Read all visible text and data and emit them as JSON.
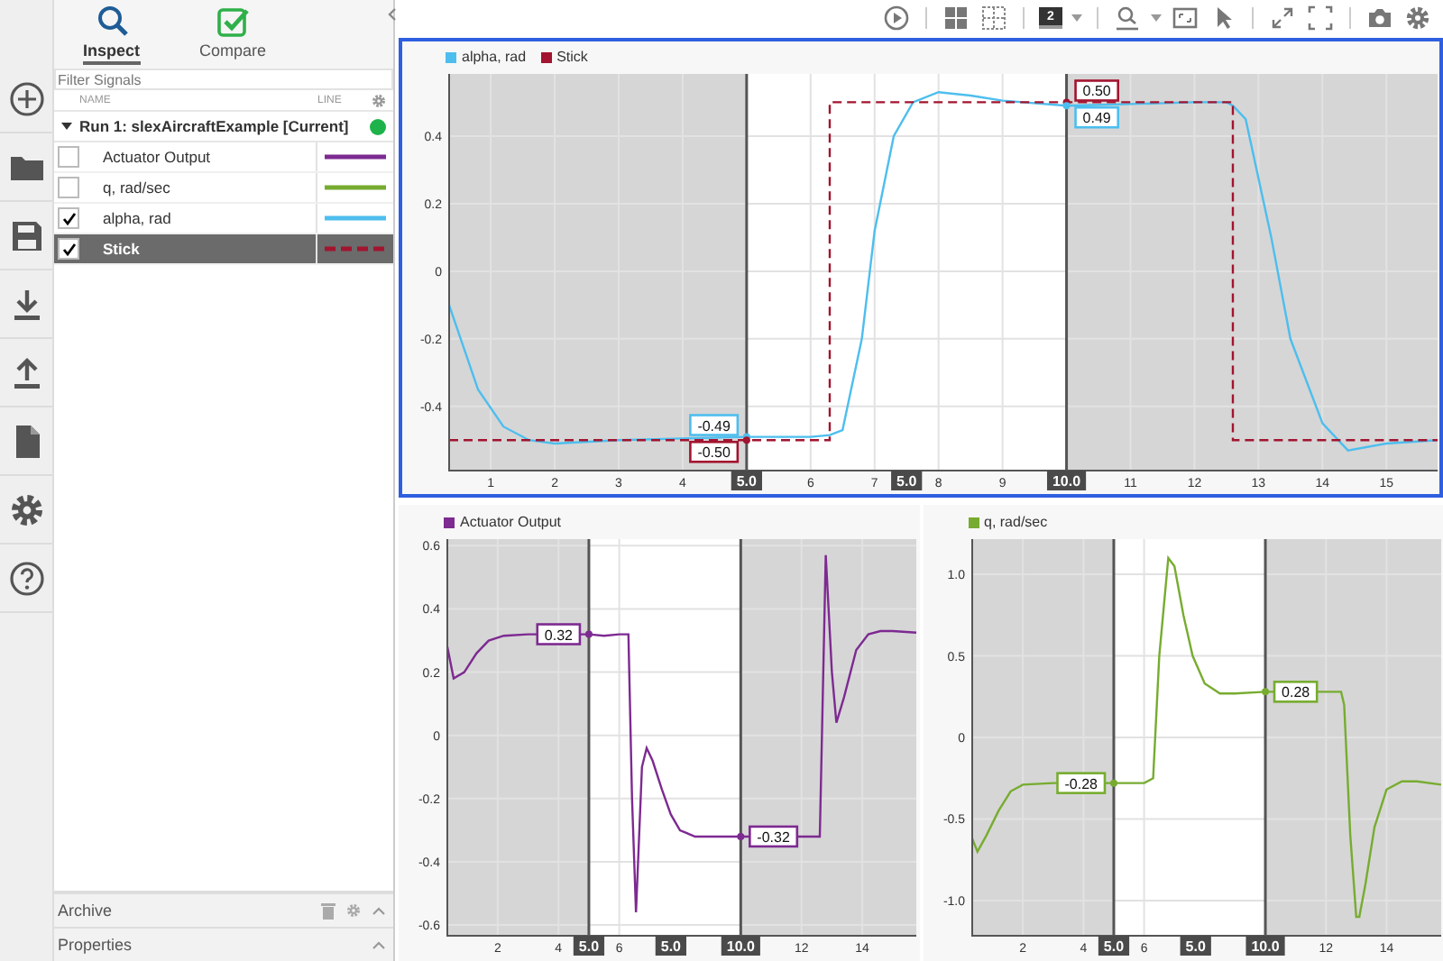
{
  "tabs": [
    {
      "label": "Inspect",
      "selected": true
    },
    {
      "label": "Compare",
      "selected": false
    }
  ],
  "filter": {
    "placeholder": "Filter Signals"
  },
  "columns": [
    "NAME",
    "LINE"
  ],
  "run": {
    "label": "Run 1: slexAircraftExample [Current]",
    "expanded": true
  },
  "signals": [
    {
      "name": "Actuator Output",
      "checked": false,
      "selected": false,
      "color": "#7d2a91",
      "dashed": false
    },
    {
      "name": "q, rad/sec",
      "checked": false,
      "selected": false,
      "color": "#77ac30",
      "dashed": false
    },
    {
      "name": "alpha, rad",
      "checked": true,
      "selected": false,
      "color": "#4dbeee",
      "dashed": false
    },
    {
      "name": "Stick",
      "checked": true,
      "selected": true,
      "color": "#a2142f",
      "dashed": true
    }
  ],
  "sections": [
    {
      "title": "Archive",
      "kind": "actions"
    },
    {
      "title": "Properties",
      "kind": "plain"
    }
  ],
  "toolbar": {
    "layout_label": "2"
  },
  "plots": [
    {
      "selected": true,
      "chart_data": {
        "type": "line",
        "grid": true,
        "x": [
          0.35,
          0.8,
          1.2,
          1.6,
          2,
          3,
          4,
          5,
          6,
          6.3,
          6.3,
          6.5,
          6.8,
          7,
          7.3,
          7.6,
          8,
          8.5,
          9,
          10,
          11,
          12,
          12.5,
          12.6,
          12.6,
          12.8,
          13.2,
          13.5,
          14,
          14.4,
          15,
          15.8
        ],
        "series": [
          {
            "name": "alpha, rad",
            "color": "#4dbeee",
            "line_style": "solid",
            "values": [
              -0.1,
              -0.35,
              -0.46,
              -0.5,
              -0.51,
              -0.5,
              -0.495,
              -0.49,
              -0.49,
              -0.485,
              -0.485,
              -0.47,
              -0.2,
              0.12,
              0.4,
              0.5,
              0.53,
              0.52,
              0.505,
              0.49,
              0.495,
              0.5,
              0.5,
              0.49,
              0.49,
              0.45,
              0.1,
              -0.2,
              -0.45,
              -0.53,
              -0.51,
              -0.5
            ]
          },
          {
            "name": "Stick",
            "color": "#a2142f",
            "line_style": "dashed",
            "values": [
              -0.5,
              -0.5,
              -0.5,
              -0.5,
              -0.5,
              -0.5,
              -0.5,
              -0.5,
              -0.5,
              -0.5,
              0.5,
              0.5,
              0.5,
              0.5,
              0.5,
              0.5,
              0.5,
              0.5,
              0.5,
              0.5,
              0.5,
              0.5,
              0.5,
              0.5,
              -0.5,
              -0.5,
              -0.5,
              -0.5,
              -0.5,
              -0.5,
              -0.5,
              -0.5
            ]
          }
        ],
        "xlim": [
          0.35,
          15.8
        ],
        "ylim": [
          -0.59,
          0.584
        ],
        "xticks": [
          1,
          2,
          3,
          4,
          6,
          7,
          8,
          9,
          11,
          12,
          13,
          14,
          15
        ],
        "yticks": [
          -0.4,
          -0.2,
          0,
          0.2,
          0.4
        ],
        "ref_lines": [
          {
            "axis": "x",
            "value": 5,
            "label": "5.0"
          },
          {
            "axis": "x",
            "value": 10,
            "label": "10.0"
          }
        ],
        "bands": [
          {
            "axis": "x",
            "from": 0.35,
            "to": 5
          },
          {
            "axis": "x",
            "from": 10,
            "to": 15.8
          }
        ],
        "annotations": [
          {
            "x": 7.5,
            "text": "5.0"
          },
          {
            "x": 5,
            "y": -0.49,
            "text": "-0.49"
          },
          {
            "x": 5,
            "y": -0.5,
            "text": "-0.50"
          },
          {
            "x": 10,
            "y": 0.5,
            "text": "0.50"
          },
          {
            "x": 10,
            "y": 0.49,
            "text": "0.49"
          }
        ]
      }
    },
    {
      "selected": false,
      "chart_data": {
        "type": "line",
        "grid": true,
        "x": [
          0.34,
          0.55,
          0.9,
          1.3,
          1.7,
          2.2,
          3,
          4,
          5,
          5.5,
          6,
          6.3,
          6.42,
          6.55,
          6.75,
          6.9,
          7.1,
          7.4,
          7.7,
          8,
          8.5,
          9,
          10,
          11,
          12,
          12.6,
          12.8,
          13.0,
          13.15,
          13.4,
          13.8,
          14.2,
          14.6,
          15,
          15.78
        ],
        "series": [
          {
            "name": "Actuator Output",
            "color": "#7d2a91",
            "line_style": "solid",
            "values": [
              0.28,
              0.18,
              0.2,
              0.26,
              0.3,
              0.315,
              0.32,
              0.32,
              0.32,
              0.315,
              0.32,
              0.32,
              -0.2,
              -0.56,
              -0.1,
              -0.04,
              -0.08,
              -0.17,
              -0.25,
              -0.3,
              -0.32,
              -0.32,
              -0.32,
              -0.32,
              -0.32,
              -0.32,
              0.57,
              0.2,
              0.04,
              0.12,
              0.27,
              0.32,
              0.33,
              0.33,
              0.325
            ]
          }
        ],
        "xlim": [
          0.34,
          15.78
        ],
        "ylim": [
          -0.634,
          0.621
        ],
        "xticks": [
          2,
          4,
          6,
          12,
          14
        ],
        "yticks": [
          -0.6,
          -0.4,
          -0.2,
          0,
          0.2,
          0.4,
          0.6
        ],
        "ref_lines": [
          {
            "axis": "x",
            "value": 5,
            "label": "5.0"
          },
          {
            "axis": "x",
            "value": 10,
            "label": "10.0"
          }
        ],
        "bands": [
          {
            "axis": "x",
            "from": 0.34,
            "to": 5
          },
          {
            "axis": "x",
            "from": 10,
            "to": 15.78
          }
        ],
        "annotations": [
          {
            "x": 7.7,
            "text": "5.0"
          },
          {
            "x": 5,
            "y": 0.32,
            "text": "0.32"
          },
          {
            "x": 10,
            "y": -0.32,
            "text": "-0.32"
          }
        ]
      }
    },
    {
      "selected": false,
      "chart_data": {
        "type": "line",
        "grid": true,
        "x": [
          0.33,
          0.5,
          0.8,
          1.2,
          1.6,
          2,
          3,
          4,
          5,
          6,
          6.3,
          6.5,
          6.8,
          7,
          7.3,
          7.6,
          8,
          8.5,
          9,
          10,
          11,
          12,
          12.5,
          12.6,
          12.8,
          13,
          13.1,
          13.3,
          13.6,
          14,
          14.5,
          15,
          15.8
        ],
        "series": [
          {
            "name": "q, rad/sec",
            "color": "#77ac30",
            "line_style": "solid",
            "values": [
              -0.62,
              -0.7,
              -0.6,
              -0.45,
              -0.33,
              -0.29,
              -0.28,
              -0.28,
              -0.28,
              -0.28,
              -0.25,
              0.5,
              1.1,
              1.05,
              0.75,
              0.5,
              0.33,
              0.27,
              0.27,
              0.28,
              0.28,
              0.28,
              0.28,
              0.2,
              -0.6,
              -1.1,
              -1.1,
              -0.9,
              -0.55,
              -0.32,
              -0.27,
              -0.27,
              -0.29
            ]
          }
        ],
        "xlim": [
          0.33,
          15.8
        ],
        "ylim": [
          -1.216,
          1.216
        ],
        "xticks": [
          2,
          4,
          6,
          12,
          14
        ],
        "yticks": [
          {
            "value": -1,
            "label": "-1.0"
          },
          -0.5,
          0,
          0.5,
          {
            "value": 1,
            "label": "1.0"
          }
        ],
        "ref_lines": [
          {
            "axis": "x",
            "value": 5,
            "label": "5.0"
          },
          {
            "axis": "x",
            "value": 10,
            "label": "10.0"
          }
        ],
        "bands": [
          {
            "axis": "x",
            "from": 0.33,
            "to": 5
          },
          {
            "axis": "x",
            "from": 10,
            "to": 15.8
          }
        ],
        "annotations": [
          {
            "x": 7.7,
            "text": "5.0"
          },
          {
            "x": 5,
            "y": -0.28,
            "text": "-0.28"
          },
          {
            "x": 10,
            "y": 0.28,
            "text": "0.28"
          }
        ]
      }
    }
  ]
}
